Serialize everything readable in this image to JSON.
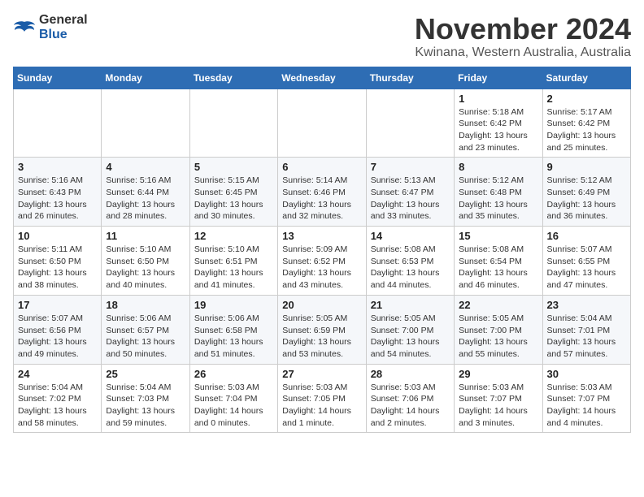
{
  "logo": {
    "text_general": "General",
    "text_blue": "Blue"
  },
  "title": {
    "month": "November 2024",
    "location": "Kwinana, Western Australia, Australia"
  },
  "headers": [
    "Sunday",
    "Monday",
    "Tuesday",
    "Wednesday",
    "Thursday",
    "Friday",
    "Saturday"
  ],
  "weeks": [
    [
      {
        "day": "",
        "detail": ""
      },
      {
        "day": "",
        "detail": ""
      },
      {
        "day": "",
        "detail": ""
      },
      {
        "day": "",
        "detail": ""
      },
      {
        "day": "",
        "detail": ""
      },
      {
        "day": "1",
        "detail": "Sunrise: 5:18 AM\nSunset: 6:42 PM\nDaylight: 13 hours\nand 23 minutes."
      },
      {
        "day": "2",
        "detail": "Sunrise: 5:17 AM\nSunset: 6:42 PM\nDaylight: 13 hours\nand 25 minutes."
      }
    ],
    [
      {
        "day": "3",
        "detail": "Sunrise: 5:16 AM\nSunset: 6:43 PM\nDaylight: 13 hours\nand 26 minutes."
      },
      {
        "day": "4",
        "detail": "Sunrise: 5:16 AM\nSunset: 6:44 PM\nDaylight: 13 hours\nand 28 minutes."
      },
      {
        "day": "5",
        "detail": "Sunrise: 5:15 AM\nSunset: 6:45 PM\nDaylight: 13 hours\nand 30 minutes."
      },
      {
        "day": "6",
        "detail": "Sunrise: 5:14 AM\nSunset: 6:46 PM\nDaylight: 13 hours\nand 32 minutes."
      },
      {
        "day": "7",
        "detail": "Sunrise: 5:13 AM\nSunset: 6:47 PM\nDaylight: 13 hours\nand 33 minutes."
      },
      {
        "day": "8",
        "detail": "Sunrise: 5:12 AM\nSunset: 6:48 PM\nDaylight: 13 hours\nand 35 minutes."
      },
      {
        "day": "9",
        "detail": "Sunrise: 5:12 AM\nSunset: 6:49 PM\nDaylight: 13 hours\nand 36 minutes."
      }
    ],
    [
      {
        "day": "10",
        "detail": "Sunrise: 5:11 AM\nSunset: 6:50 PM\nDaylight: 13 hours\nand 38 minutes."
      },
      {
        "day": "11",
        "detail": "Sunrise: 5:10 AM\nSunset: 6:50 PM\nDaylight: 13 hours\nand 40 minutes."
      },
      {
        "day": "12",
        "detail": "Sunrise: 5:10 AM\nSunset: 6:51 PM\nDaylight: 13 hours\nand 41 minutes."
      },
      {
        "day": "13",
        "detail": "Sunrise: 5:09 AM\nSunset: 6:52 PM\nDaylight: 13 hours\nand 43 minutes."
      },
      {
        "day": "14",
        "detail": "Sunrise: 5:08 AM\nSunset: 6:53 PM\nDaylight: 13 hours\nand 44 minutes."
      },
      {
        "day": "15",
        "detail": "Sunrise: 5:08 AM\nSunset: 6:54 PM\nDaylight: 13 hours\nand 46 minutes."
      },
      {
        "day": "16",
        "detail": "Sunrise: 5:07 AM\nSunset: 6:55 PM\nDaylight: 13 hours\nand 47 minutes."
      }
    ],
    [
      {
        "day": "17",
        "detail": "Sunrise: 5:07 AM\nSunset: 6:56 PM\nDaylight: 13 hours\nand 49 minutes."
      },
      {
        "day": "18",
        "detail": "Sunrise: 5:06 AM\nSunset: 6:57 PM\nDaylight: 13 hours\nand 50 minutes."
      },
      {
        "day": "19",
        "detail": "Sunrise: 5:06 AM\nSunset: 6:58 PM\nDaylight: 13 hours\nand 51 minutes."
      },
      {
        "day": "20",
        "detail": "Sunrise: 5:05 AM\nSunset: 6:59 PM\nDaylight: 13 hours\nand 53 minutes."
      },
      {
        "day": "21",
        "detail": "Sunrise: 5:05 AM\nSunset: 7:00 PM\nDaylight: 13 hours\nand 54 minutes."
      },
      {
        "day": "22",
        "detail": "Sunrise: 5:05 AM\nSunset: 7:00 PM\nDaylight: 13 hours\nand 55 minutes."
      },
      {
        "day": "23",
        "detail": "Sunrise: 5:04 AM\nSunset: 7:01 PM\nDaylight: 13 hours\nand 57 minutes."
      }
    ],
    [
      {
        "day": "24",
        "detail": "Sunrise: 5:04 AM\nSunset: 7:02 PM\nDaylight: 13 hours\nand 58 minutes."
      },
      {
        "day": "25",
        "detail": "Sunrise: 5:04 AM\nSunset: 7:03 PM\nDaylight: 13 hours\nand 59 minutes."
      },
      {
        "day": "26",
        "detail": "Sunrise: 5:03 AM\nSunset: 7:04 PM\nDaylight: 14 hours\nand 0 minutes."
      },
      {
        "day": "27",
        "detail": "Sunrise: 5:03 AM\nSunset: 7:05 PM\nDaylight: 14 hours\nand 1 minute."
      },
      {
        "day": "28",
        "detail": "Sunrise: 5:03 AM\nSunset: 7:06 PM\nDaylight: 14 hours\nand 2 minutes."
      },
      {
        "day": "29",
        "detail": "Sunrise: 5:03 AM\nSunset: 7:07 PM\nDaylight: 14 hours\nand 3 minutes."
      },
      {
        "day": "30",
        "detail": "Sunrise: 5:03 AM\nSunset: 7:07 PM\nDaylight: 14 hours\nand 4 minutes."
      }
    ]
  ]
}
